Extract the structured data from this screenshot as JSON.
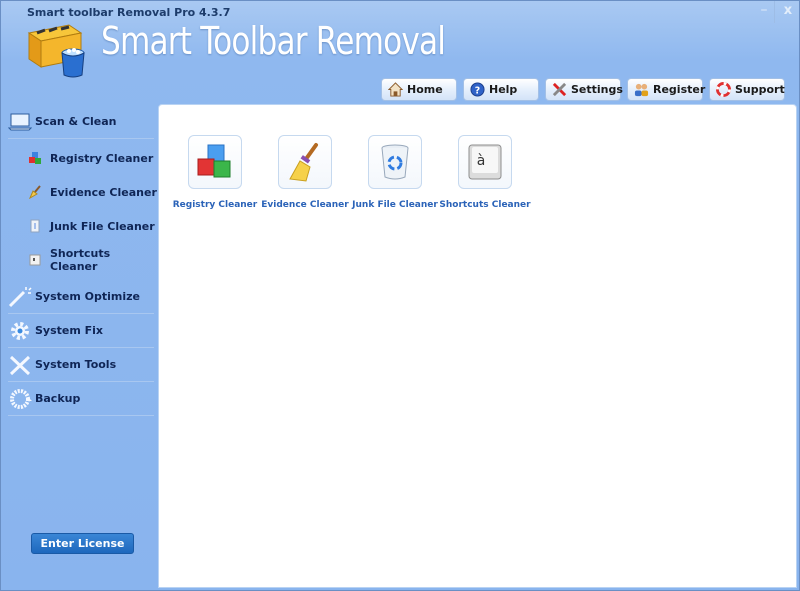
{
  "window": {
    "title": "Smart toolbar Removal Pro 4.3.7",
    "brand": "Smart Toolbar Removal",
    "minimize_glyph": "–",
    "close_glyph": "x"
  },
  "toolbar": {
    "buttons": [
      {
        "label": "Home",
        "icon": "home-icon"
      },
      {
        "label": "Help",
        "icon": "help-icon"
      },
      {
        "label": "Settings",
        "icon": "settings-icon"
      },
      {
        "label": "Register",
        "icon": "register-icon"
      },
      {
        "label": "Support",
        "icon": "support-icon"
      }
    ]
  },
  "sidebar": {
    "sections": [
      {
        "label": "Scan & Clean",
        "icon": "laptop-icon",
        "active": true
      },
      {
        "label": "System Optimize",
        "icon": "magic-wand-icon"
      },
      {
        "label": "System Fix",
        "icon": "gear-icon"
      },
      {
        "label": "System Tools",
        "icon": "tools-icon"
      },
      {
        "label": "Backup",
        "icon": "backup-icon"
      }
    ],
    "sub_items": [
      {
        "label": "Registry Cleaner",
        "icon": "registry-icon"
      },
      {
        "label": "Evidence Cleaner",
        "icon": "broom-icon"
      },
      {
        "label": "Junk File Cleaner",
        "icon": "junk-file-icon"
      },
      {
        "label": "Shortcuts Cleaner",
        "icon": "shortcut-icon"
      }
    ],
    "license_button": "Enter License"
  },
  "content": {
    "tiles": [
      {
        "label": "Registry Cleaner",
        "icon": "registry-cubes-icon"
      },
      {
        "label": "Evidence Cleaner",
        "icon": "broom-icon"
      },
      {
        "label": "Junk File Cleaner",
        "icon": "recycle-bin-icon"
      },
      {
        "label": "Shortcuts Cleaner",
        "icon": "keyboard-key-icon"
      }
    ],
    "key_glyph": "à"
  },
  "colors": {
    "accent": "#1e68bd",
    "nav_text": "#0f2555",
    "tile_label": "#2b63b8",
    "window_bg": "#89b4ee"
  }
}
